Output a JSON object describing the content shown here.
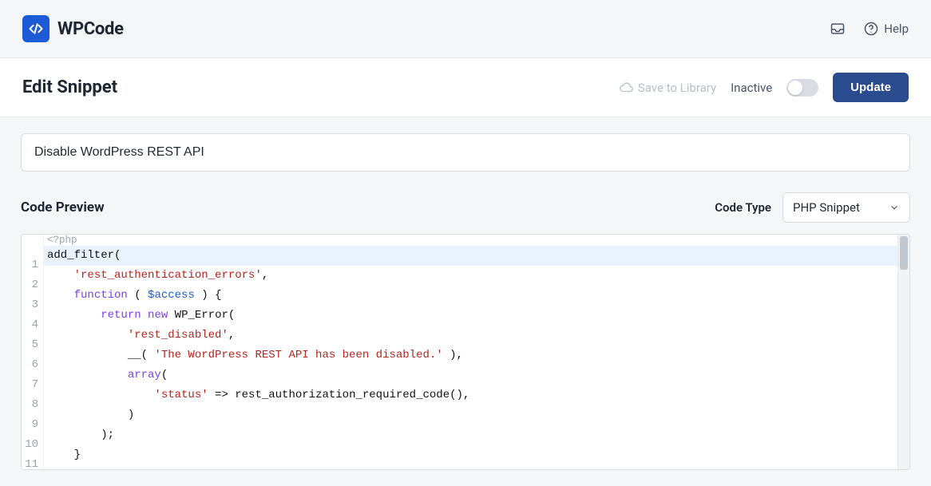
{
  "brand": {
    "name": "WPCode"
  },
  "top": {
    "help_label": "Help"
  },
  "header": {
    "title": "Edit Snippet",
    "save_library_label": "Save to Library",
    "status_label": "Inactive",
    "update_label": "Update"
  },
  "snippet": {
    "title": "Disable WordPress REST API"
  },
  "code_preview": {
    "section_label": "Code Preview",
    "code_type_label": "Code Type",
    "code_type_value": "PHP Snippet"
  },
  "editor": {
    "open_tag": "<?php",
    "lines": [
      {
        "n": 1,
        "tokens": [
          {
            "t": "add_filter(",
            "c": "fn"
          }
        ]
      },
      {
        "n": 2,
        "tokens": [
          {
            "t": "    ",
            "c": "p"
          },
          {
            "t": "'rest_authentication_errors'",
            "c": "str"
          },
          {
            "t": ",",
            "c": "p"
          }
        ]
      },
      {
        "n": 3,
        "tokens": [
          {
            "t": "    ",
            "c": "p"
          },
          {
            "t": "function",
            "c": "kw"
          },
          {
            "t": " ( ",
            "c": "p"
          },
          {
            "t": "$access",
            "c": "var"
          },
          {
            "t": " ) {",
            "c": "p"
          }
        ]
      },
      {
        "n": 4,
        "tokens": [
          {
            "t": "        ",
            "c": "p"
          },
          {
            "t": "return",
            "c": "kw"
          },
          {
            "t": " ",
            "c": "p"
          },
          {
            "t": "new",
            "c": "kw"
          },
          {
            "t": " WP_Error(",
            "c": "fn"
          }
        ]
      },
      {
        "n": 5,
        "tokens": [
          {
            "t": "            ",
            "c": "p"
          },
          {
            "t": "'rest_disabled'",
            "c": "str"
          },
          {
            "t": ",",
            "c": "p"
          }
        ]
      },
      {
        "n": 6,
        "tokens": [
          {
            "t": "            __( ",
            "c": "fn"
          },
          {
            "t": "'The WordPress REST API has been disabled.'",
            "c": "str"
          },
          {
            "t": " ),",
            "c": "p"
          }
        ]
      },
      {
        "n": 7,
        "tokens": [
          {
            "t": "            ",
            "c": "p"
          },
          {
            "t": "array",
            "c": "kw"
          },
          {
            "t": "(",
            "c": "p"
          }
        ]
      },
      {
        "n": 8,
        "tokens": [
          {
            "t": "                ",
            "c": "p"
          },
          {
            "t": "'status'",
            "c": "str"
          },
          {
            "t": " => rest_authorization_required_code(),",
            "c": "fn"
          }
        ]
      },
      {
        "n": 9,
        "tokens": [
          {
            "t": "            )",
            "c": "p"
          }
        ]
      },
      {
        "n": 10,
        "tokens": [
          {
            "t": "        );",
            "c": "p"
          }
        ]
      },
      {
        "n": 11,
        "tokens": [
          {
            "t": "    }",
            "c": "p"
          }
        ]
      }
    ]
  }
}
